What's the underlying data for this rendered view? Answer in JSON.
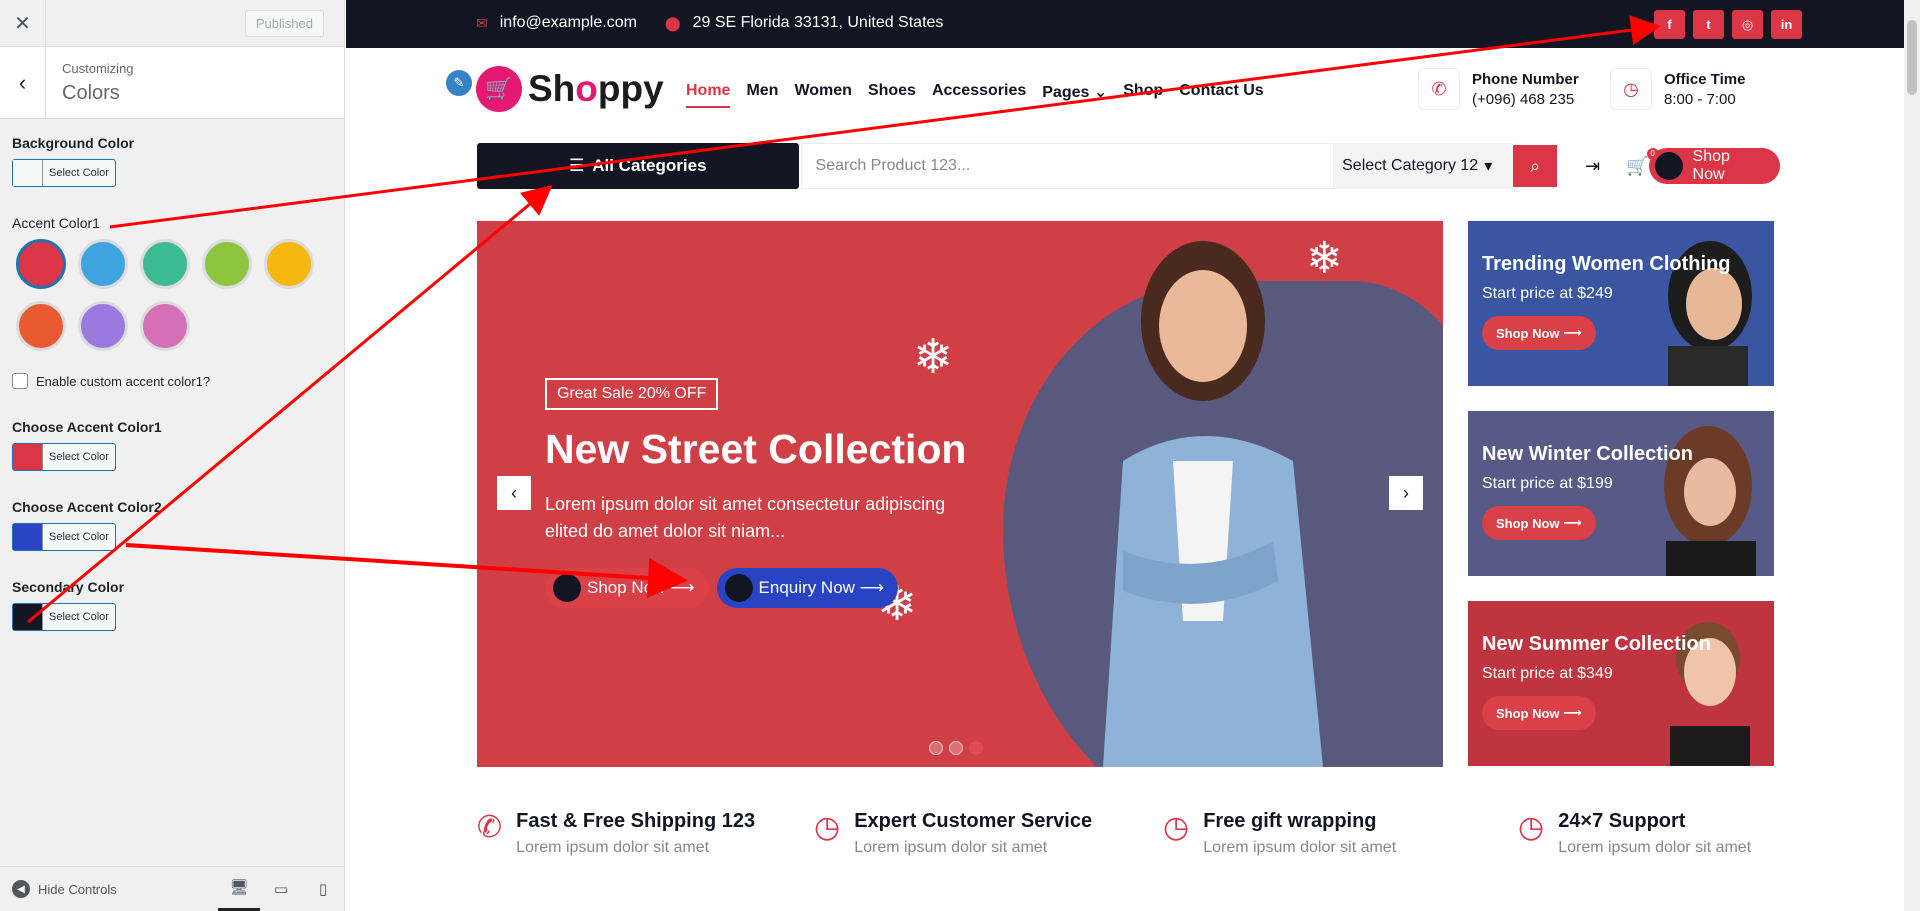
{
  "customizer": {
    "published_label": "Published",
    "section_sub": "Customizing",
    "section_title": "Colors",
    "bg_color_label": "Background Color",
    "select_color_label": "Select Color",
    "accent_label": "Accent Color1",
    "accent_swatches": [
      "#dc3545",
      "#3fa3e0",
      "#3cba91",
      "#8cc63f",
      "#f5b80f",
      "#e85a32",
      "#9b7ae0",
      "#d46fb8"
    ],
    "enable_custom_label": "Enable custom accent color1?",
    "choose_accent1_label": "Choose Accent Color1",
    "choose_accent2_label": "Choose Accent Color2",
    "secondary_label": "Secondary Color",
    "hide_controls_label": "Hide Controls",
    "colors": {
      "background": "#f6f7f7",
      "accent1": "#dc3545",
      "accent2": "#2844c4",
      "secondary": "#131523"
    }
  },
  "site": {
    "topbar": {
      "email": "info@example.com",
      "address": "29 SE Florida 33131, United States",
      "socials": [
        "f",
        "t",
        "ig",
        "in"
      ]
    },
    "logo_text_a": "Sh",
    "logo_text_b": "o",
    "logo_text_c": "ppy",
    "nav": [
      "Home",
      "Men",
      "Women",
      "Shoes",
      "Accessories",
      "Pages",
      "Shop",
      "Contact Us"
    ],
    "phone_title": "Phone Number",
    "phone_value": "(+096) 468 235",
    "office_title": "Office Time",
    "office_value": "8:00 - 7:00",
    "all_categories": "All Categories",
    "search_placeholder": "Search Product 123...",
    "select_category": "Select Category 12",
    "cart_count": "0",
    "shop_now": "Shop Now",
    "hero": {
      "badge": "Great Sale 20% OFF",
      "title": "New Street Collection",
      "desc": "Lorem ipsum dolor sit amet consectetur adipiscing elited do amet dolor sit niam...",
      "btn1": "Shop Now",
      "btn2": "Enquiry Now"
    },
    "promos": [
      {
        "title": "Trending Women Clothing",
        "price": "Start price at $249",
        "btn": "Shop Now",
        "bg": "#3a55a2"
      },
      {
        "title": "New Winter Collection",
        "price": "Start price at $199",
        "btn": "Shop Now",
        "bg": "#575a86"
      },
      {
        "title": "New Summer Collection",
        "price": "Start price at $349",
        "btn": "Shop Now",
        "bg": "#c03440"
      }
    ],
    "features": [
      {
        "title": "Fast & Free Shipping 123",
        "sub": "Lorem ipsum dolor sit amet"
      },
      {
        "title": "Expert Customer Service",
        "sub": "Lorem ipsum dolor sit amet"
      },
      {
        "title": "Free gift wrapping",
        "sub": "Lorem ipsum dolor sit amet"
      },
      {
        "title": "24×7 Support",
        "sub": "Lorem ipsum dolor sit amet"
      }
    ]
  }
}
